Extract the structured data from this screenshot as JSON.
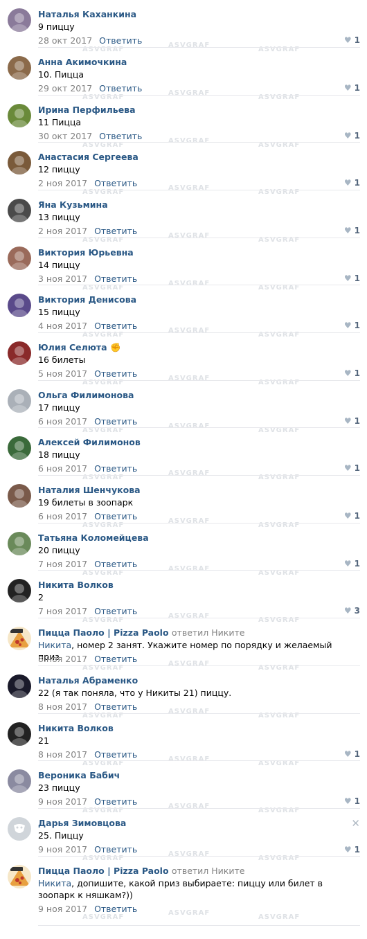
{
  "watermark": "ASVGRAF",
  "reply_label": "Ответить",
  "comments": [
    {
      "name": "Наталья Каханкина",
      "text": "9 пиццу",
      "date": "28 окт 2017",
      "likes": "1",
      "av": "#8a7a9a"
    },
    {
      "name": "Анна Акимочкина",
      "text": "10. Пицца",
      "date": "29 окт 2017",
      "likes": "1",
      "av": "#8b6a4a"
    },
    {
      "name": "Ирина Перфильева",
      "text": "11 Пицца",
      "date": "30 окт 2017",
      "likes": "1",
      "av": "#6a8a3a"
    },
    {
      "name": "Анастасия Сергеева",
      "text": "12 пиццу",
      "date": "2 ноя 2017",
      "likes": "1",
      "av": "#7a5a3a"
    },
    {
      "name": "Яна Кузьмина",
      "text": "13 пиццу",
      "date": "2 ноя 2017",
      "likes": "1",
      "av": "#4a4a4a"
    },
    {
      "name": "Виктория Юрьевна",
      "text": "14 пиццу",
      "date": "3 ноя 2017",
      "likes": "1",
      "av": "#9a6a5a"
    },
    {
      "name": "Виктория Денисова",
      "text": "15 пиццу",
      "date": "4 ноя 2017",
      "likes": "1",
      "av": "#5a4a8a"
    },
    {
      "name": "Юлия Селюта",
      "emoji": "✊",
      "text": "16 билеты",
      "date": "5 ноя 2017",
      "likes": "1",
      "av": "#8a2a2a"
    },
    {
      "name": "Ольга Филимонова",
      "text": "17 пиццу",
      "date": "6 ноя 2017",
      "likes": "1",
      "av": "#aab0b8"
    },
    {
      "name": "Алексей Филимонов",
      "text": "18 пиццу",
      "date": "6 ноя 2017",
      "likes": "1",
      "av": "#3a6a3a"
    },
    {
      "name": "Наталия Шенчукова",
      "text": "19 билеты в зоопарк",
      "date": "6 ноя 2017",
      "likes": "1",
      "av": "#7a5a4a"
    },
    {
      "name": "Татьяна Коломейцева",
      "text": "20 пиццу",
      "date": "7 ноя 2017",
      "likes": "1",
      "av": "#6a8a5a"
    },
    {
      "name": "Никита Волков",
      "text": "2",
      "date": "7 ноя 2017",
      "likes": "3",
      "av": "#222222"
    },
    {
      "name": "Пицца Паоло | Pizza Paolo",
      "reply_to": "ответил Никите",
      "mention": "Никита",
      "text": ", номер 2 занят. Укажите номер по порядку и желаемый приз",
      "date": "8 ноя 2017",
      "likes": "",
      "av": "#e8a040"
    },
    {
      "name": "Наталья Абраменко",
      "text": "22 (я так поняла, что у Никиты 21) пиццу.",
      "date": "8 ноя 2017",
      "likes": "",
      "av": "#1a1a2a"
    },
    {
      "name": "Никита Волков",
      "text": "21",
      "date": "8 ноя 2017",
      "likes": "1",
      "av": "#222222"
    },
    {
      "name": "Вероника Бабич",
      "text": "23 пиццу",
      "date": "9 ноя 2017",
      "likes": "1",
      "av": "#8a8aa0"
    },
    {
      "name": "Дарья Зимовцова",
      "text": "25. Пиццу",
      "date": "9 ноя 2017",
      "likes": "1",
      "av": "#d0d5da",
      "close": "✕"
    },
    {
      "name": "Пицца Паоло | Pizza Paolo",
      "reply_to": "ответил Никите",
      "mention": "Никита",
      "text": ", допишите, какой приз выбираете: пиццу или билет в зоопарк к няшкам?))",
      "date": "9 ноя 2017",
      "likes": "",
      "av": "#e8a040"
    }
  ]
}
